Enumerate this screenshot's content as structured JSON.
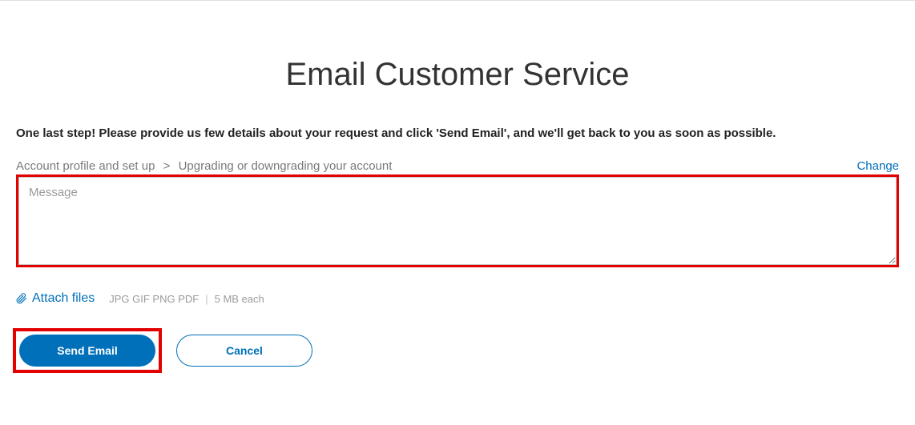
{
  "title": "Email Customer Service",
  "instruction": "One last step! Please provide us few details about your request and click 'Send Email', and we'll get back to you as soon as possible.",
  "breadcrumb": {
    "level1": "Account profile and set up",
    "level2": "Upgrading or downgrading your account",
    "change_label": "Change"
  },
  "message": {
    "placeholder": "Message",
    "value": ""
  },
  "attach": {
    "label": "Attach files",
    "formats": "JPG GIF PNG PDF",
    "limit": "5 MB each"
  },
  "buttons": {
    "send": "Send Email",
    "cancel": "Cancel"
  }
}
